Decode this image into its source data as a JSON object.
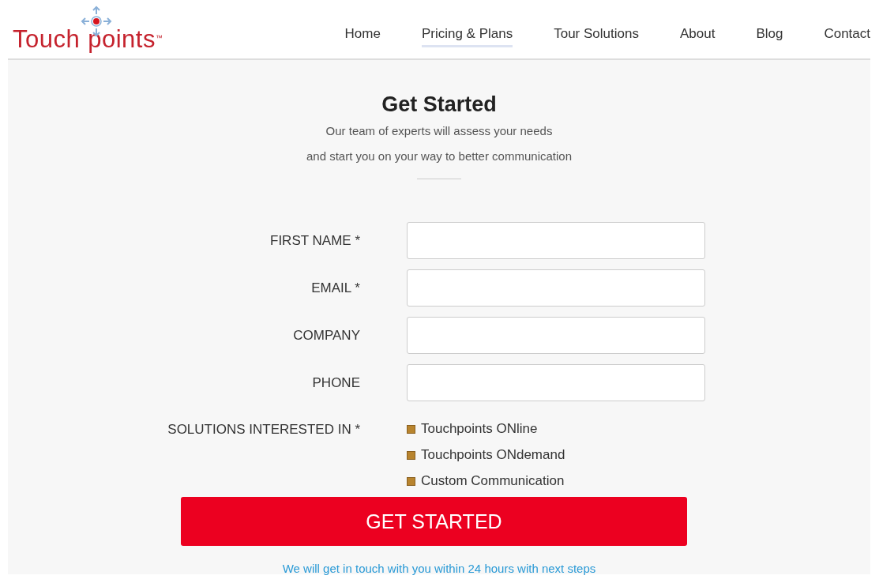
{
  "logo": {
    "part_1": "Touch",
    "part_2": "points",
    "mark": "™"
  },
  "nav": [
    {
      "label": "Home",
      "selected": false
    },
    {
      "label": "Pricing & Plans",
      "selected": true
    },
    {
      "label": "Tour Solutions",
      "selected": false
    },
    {
      "label": "About",
      "selected": false
    },
    {
      "label": "Blog",
      "selected": false
    },
    {
      "label": "Contact",
      "selected": false
    }
  ],
  "heading": "Get Started",
  "subtitle": [
    "Our team of experts will assess your needs",
    "and start you on your way to better communication"
  ],
  "fields": [
    {
      "label": "FIRST NAME *"
    },
    {
      "label": "EMAIL *"
    },
    {
      "label": "COMPANY"
    },
    {
      "label": "PHONE"
    }
  ],
  "solutions": {
    "label": "SOLUTIONS INTERESTED IN *",
    "options": [
      {
        "label": "Touchpoints ONline",
        "checked": false
      },
      {
        "label": "Touchpoints ONdemand",
        "checked": false
      },
      {
        "label": "Custom Communication",
        "checked": false
      }
    ]
  },
  "submit": "GET STARTED",
  "note": "We will get in touch with you within 24 hours with next steps"
}
